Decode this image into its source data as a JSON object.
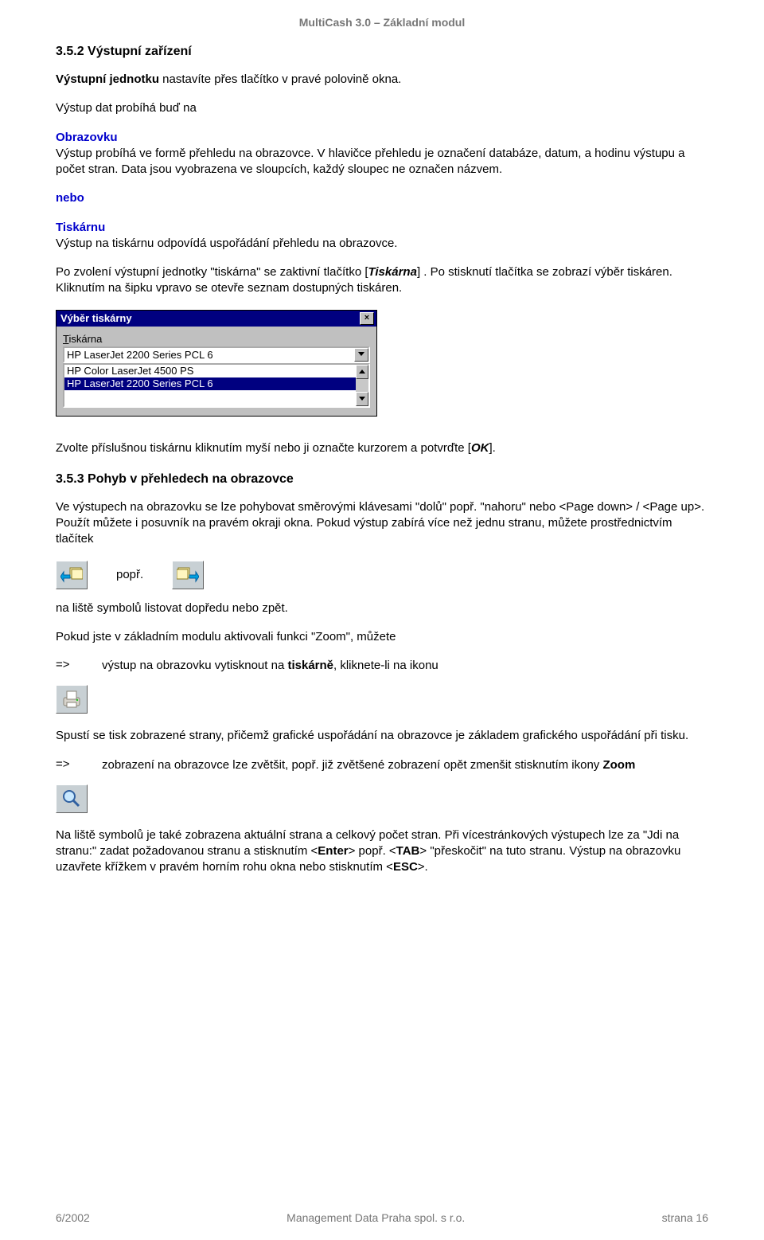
{
  "header": "MultiCash 3.0 – Základní modul",
  "s1": {
    "title": "3.5.2  Výstupní zařízení",
    "p1_a": "Výstupní jednotku",
    "p1_b": " nastavíte přes tlačítko v pravé polovině okna.",
    "p2": "Výstup dat probíhá buď na",
    "p3_label": "Obrazovku",
    "p3_body": "Výstup probíhá ve formě přehledu na obrazovce. V hlavičce přehledu je označení databáze, datum, a hodinu výstupu a počet stran. Data jsou vyobrazena ve sloupcích, každý sloupec ne označen názvem.",
    "nebo": "nebo",
    "p4_label": "Tiskárnu",
    "p4_body": "Výstup na tiskárnu odpovídá uspořádání přehledu na obrazovce.",
    "p5_a": "Po zvolení výstupní jednotky \"tiskárna\" se zaktivní tlačítko [",
    "p5_b": "Tiskárna",
    "p5_c": "] . Po stisknutí tlačítka se zobrazí výběr tiskáren. Kliknutím na šipku vpravo se otevře seznam dostupných tiskáren."
  },
  "dialog": {
    "title": "Výběr tiskárny",
    "close": "×",
    "label_prefix": "T",
    "label_rest": "iskárna",
    "selected": "HP LaserJet 2200 Series PCL 6",
    "options": [
      "HP Color LaserJet 4500 PS",
      "HP LaserJet 2200 Series PCL 6"
    ],
    "selected_index": 1
  },
  "s1b": {
    "p6_a": "Zvolte příslušnou tiskárnu kliknutím myší nebo ji označte kurzorem a potvrďte [",
    "p6_b": "OK",
    "p6_c": "]."
  },
  "s2": {
    "title": "3.5.3  Pohyb v přehledech na obrazovce",
    "p1": "Ve výstupech na obrazovku se lze pohybovat směrovými klávesami \"dolů\" popř. \"nahoru\" nebo <Page down> / <Page up>. Použít můžete i posuvník na pravém okraji okna. Pokud výstup zabírá více než jednu stranu, můžete prostřednictvím tlačítek",
    "popr": "popř.",
    "p2": "na liště symbolů listovat dopředu nebo zpět.",
    "p3_a": "Pokud jste v základním modulu aktivovali funkci \"Zoom\", můžete",
    "arrow1": "=>",
    "p3_b_a": "výstup na obrazovku vytisknout na ",
    "p3_b_b": "tiskárně",
    "p3_b_c": ", kliknete-li na ikonu",
    "p4": "Spustí se tisk zobrazené strany, přičemž grafické uspořádání na obrazovce je základem grafického uspořádání při tisku.",
    "arrow2": "=>",
    "p5_a": "zobrazení na obrazovce lze zvětšit, popř. již zvětšené zobrazení opět zmenšit stisknutím ikony ",
    "p5_b": "Zoom",
    "p6_a": "Na liště symbolů je také zobrazena aktuální strana a celkový počet stran. Při vícestránkových výstupech lze za \"Jdi na stranu:\" zadat požadovanou stranu a stisknutím <",
    "p6_b": "Enter",
    "p6_c": "> popř. <",
    "p6_d": "TAB",
    "p6_e": "> \"přeskočit\" na tuto stranu. Výstup na obrazovku uzavřete křížkem v pravém horním rohu okna nebo stisknutím <",
    "p6_f": "ESC",
    "p6_g": ">."
  },
  "footer": {
    "left": "6/2002",
    "center": "Management Data Praha spol. s r.o.",
    "right": "strana 16"
  }
}
